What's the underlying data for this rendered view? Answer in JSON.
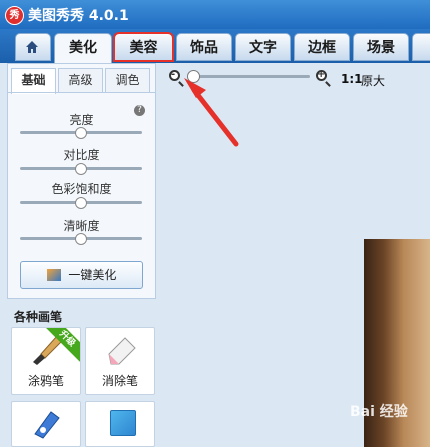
{
  "app": {
    "logo_char": "秀",
    "title": "美图秀秀 4.0.1"
  },
  "tabs": [
    {
      "label": "美化",
      "state": "active"
    },
    {
      "label": "美容",
      "state": "highlighted"
    },
    {
      "label": "饰品"
    },
    {
      "label": "文字"
    },
    {
      "label": "边框"
    },
    {
      "label": "场景"
    }
  ],
  "left_panel": {
    "subtabs": [
      "基础",
      "高级",
      "调色"
    ],
    "sliders": [
      {
        "label": "亮度",
        "level": 0.5
      },
      {
        "label": "对比度",
        "level": 0.5
      },
      {
        "label": "色彩饱和度",
        "level": 0.5
      },
      {
        "label": "清晰度",
        "level": 0.5
      }
    ],
    "oneclick_label": "一键美化"
  },
  "brushes": {
    "title": "各种画笔",
    "items": [
      {
        "label": "涂鸦笔",
        "badge": "升级"
      },
      {
        "label": "消除笔"
      }
    ]
  },
  "zoom": {
    "ratio": "1:1",
    "original": "原大",
    "level": 0.0
  },
  "watermark": "Bai 经验",
  "colors": {
    "highlight_box": "#e5312a",
    "arrow": "#e5312a",
    "title_bar": "#2a7ad0"
  }
}
